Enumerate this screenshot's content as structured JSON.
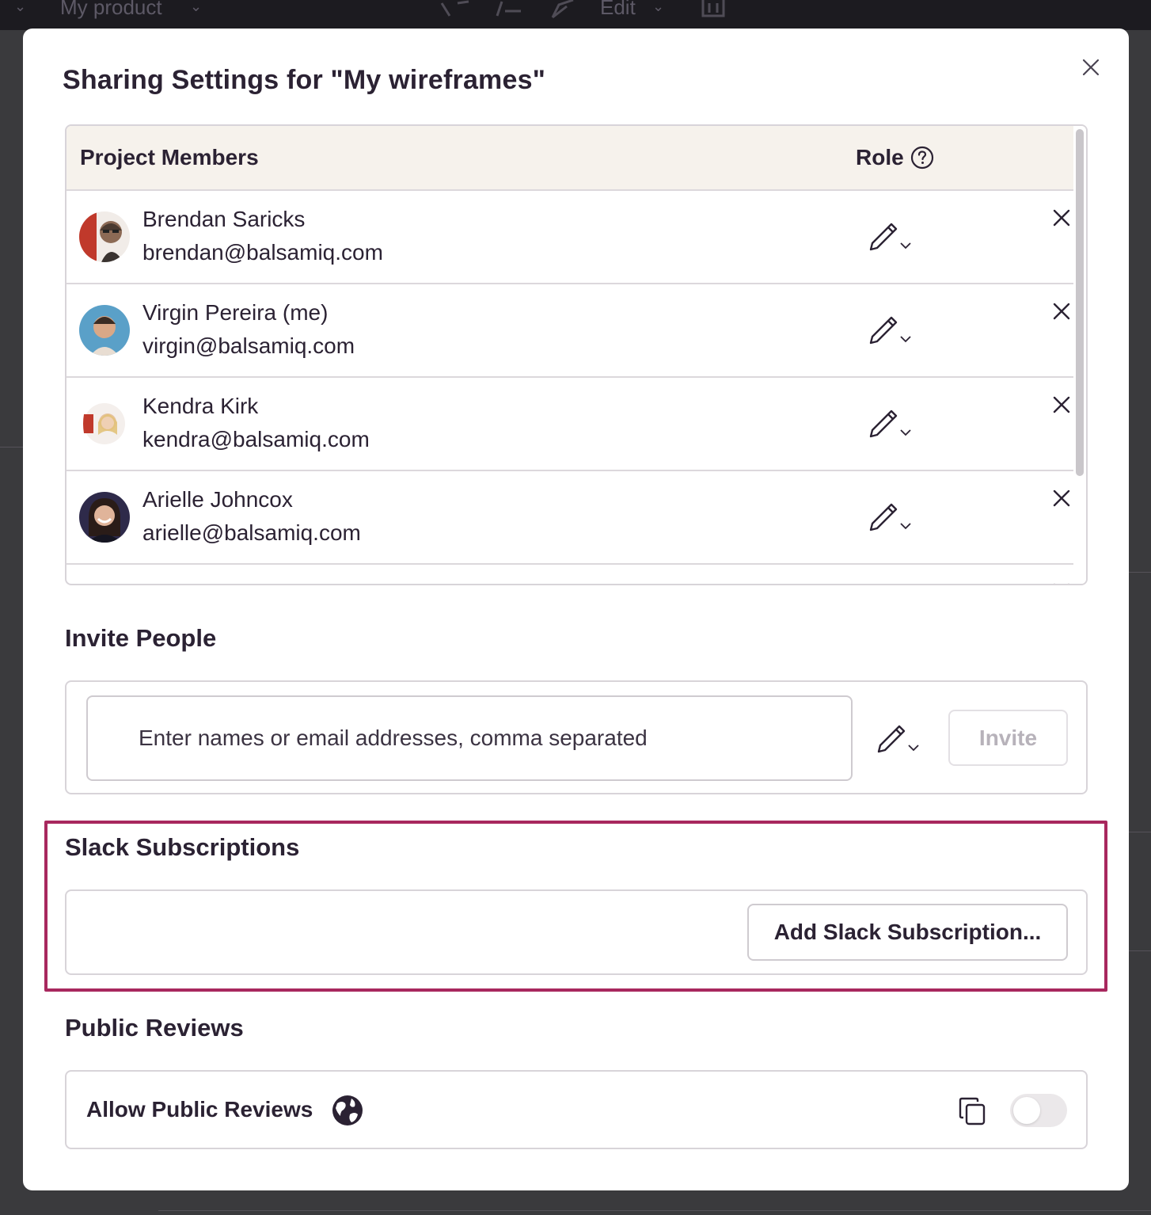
{
  "topbar": {
    "project": "My product",
    "edit": "Edit"
  },
  "modal": {
    "title": "Sharing Settings for \"My wireframes\""
  },
  "members": {
    "header_members": "Project Members",
    "header_role": "Role",
    "rows": [
      {
        "name": "Brendan Saricks",
        "email": "brendan@balsamiq.com",
        "role_icon": "pencil-icon"
      },
      {
        "name": "Virgin Pereira (me)",
        "email": "virgin@balsamiq.com",
        "role_icon": "pencil-icon"
      },
      {
        "name": "Kendra Kirk",
        "email": "kendra@balsamiq.com",
        "role_icon": "pencil-icon"
      },
      {
        "name": "Arielle Johncox",
        "email": "arielle@balsamiq.com",
        "role_icon": "pencil-icon"
      }
    ]
  },
  "invite": {
    "title": "Invite People",
    "placeholder": "Enter names or email addresses, comma separated",
    "button": "Invite"
  },
  "slack": {
    "title": "Slack Subscriptions",
    "button": "Add Slack Subscription..."
  },
  "public_reviews": {
    "title": "Public Reviews",
    "label": "Allow Public Reviews",
    "toggle_on": false
  },
  "colors": {
    "text": "#2b2233",
    "highlight": "#a8285e",
    "header_bg": "#f6f2ec"
  }
}
